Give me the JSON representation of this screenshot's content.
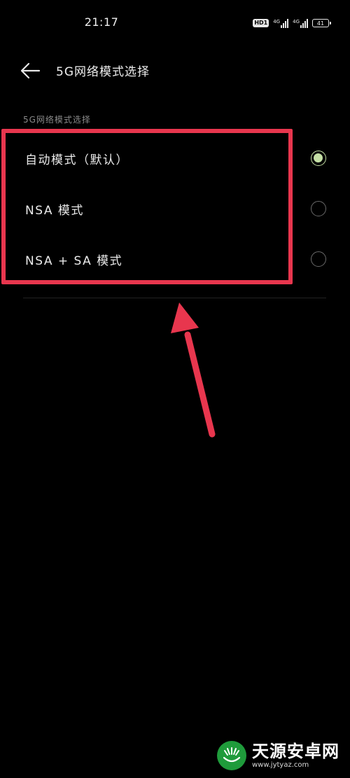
{
  "status_bar": {
    "time": "21:17",
    "hd_badge": "HD1",
    "net1_label": "4G",
    "net2_label": "4G",
    "battery_level": "41"
  },
  "header": {
    "title": "5G网络模式选择",
    "back_icon": "arrow-left-icon"
  },
  "section": {
    "header": "5G网络模式选择"
  },
  "options": [
    {
      "label": "自动模式（默认）",
      "selected": true
    },
    {
      "label": "NSA 模式",
      "selected": false
    },
    {
      "label": "NSA + SA 模式",
      "selected": false
    }
  ],
  "annotation": {
    "box_color": "#e8364e",
    "arrow_color": "#e8364e"
  },
  "radio": {
    "checked_color": "#c5e0a5",
    "unchecked_color": "#6a6a6a"
  },
  "watermark": {
    "title": "天源安卓网",
    "url": "www.jytyaz.com",
    "logo_color": "#1f9b3b"
  }
}
